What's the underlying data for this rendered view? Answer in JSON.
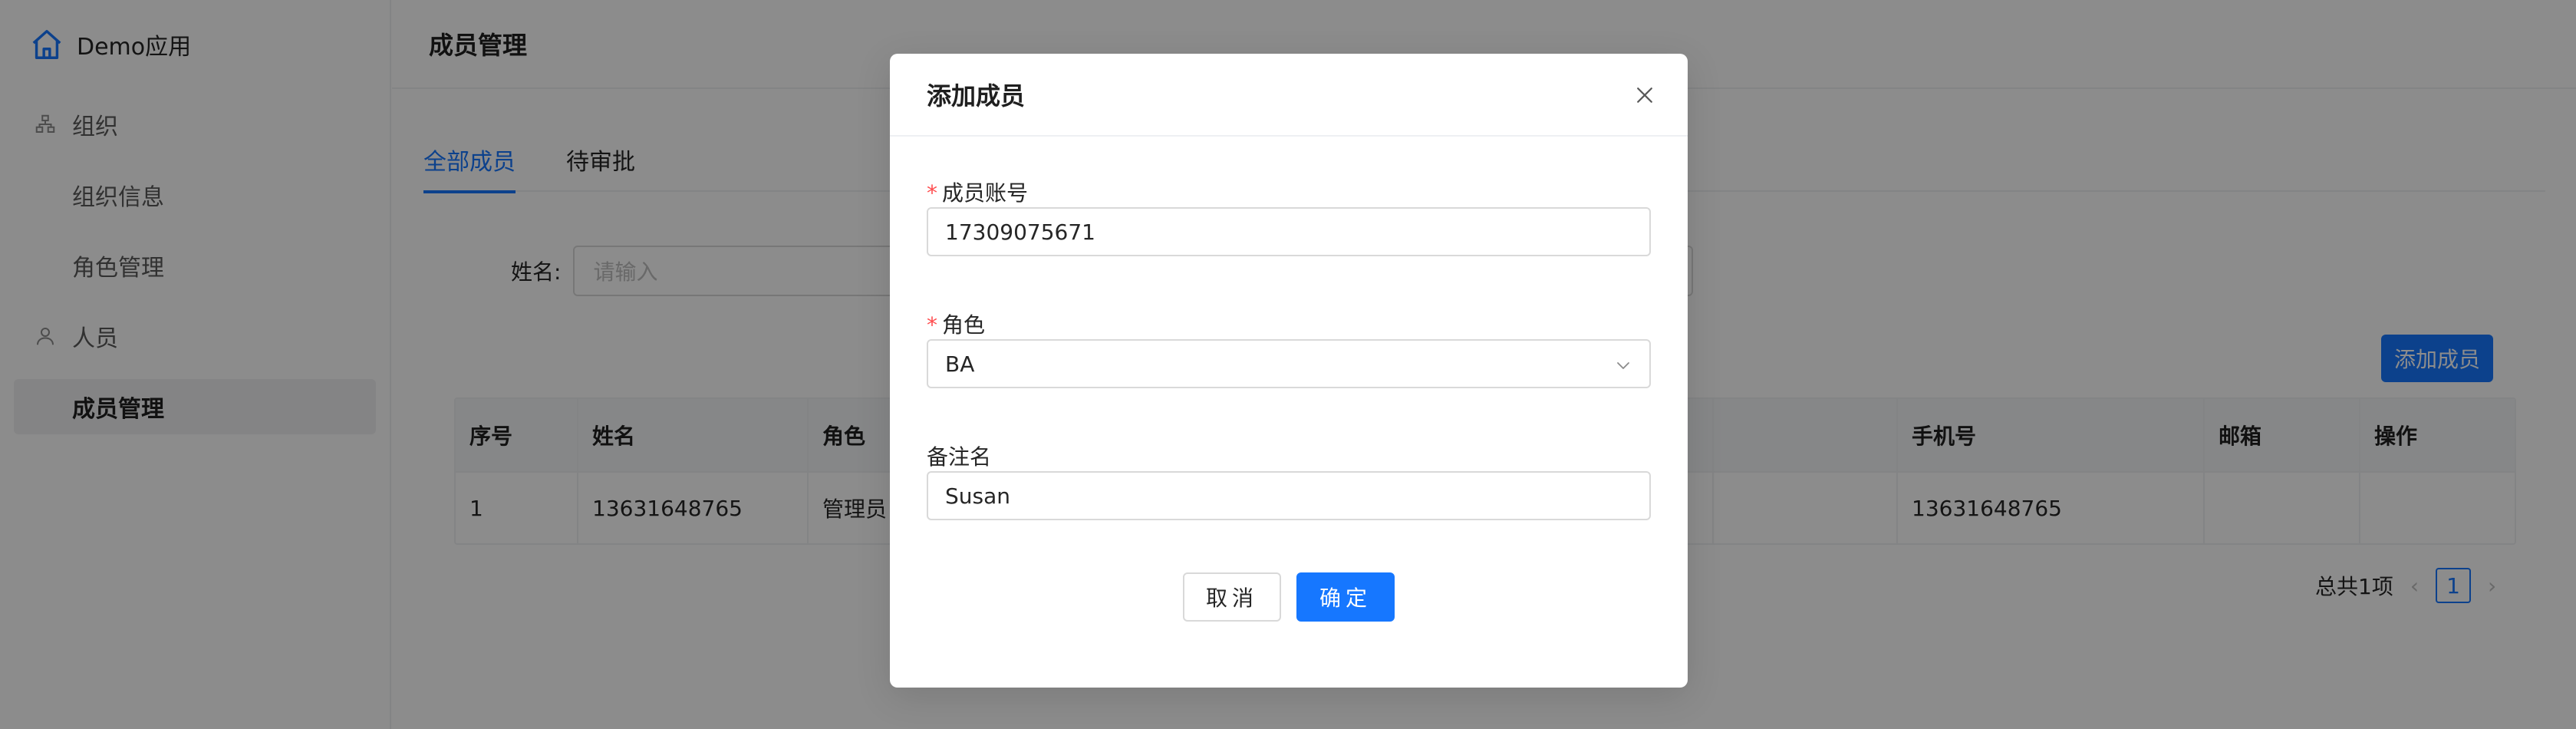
{
  "app": {
    "brand": "Demo应用",
    "page_title": "成员管理"
  },
  "sidebar": {
    "groups": [
      {
        "label": "组织",
        "icon": "org-icon",
        "items": [
          "组织信息",
          "角色管理"
        ]
      },
      {
        "label": "人员",
        "icon": "user-icon",
        "items": [
          "成员管理"
        ]
      }
    ],
    "active_item": "成员管理"
  },
  "tabs": [
    {
      "label": "全部成员",
      "active": true
    },
    {
      "label": "待审批",
      "active": false
    }
  ],
  "filter": {
    "name_label": "姓名:",
    "name_placeholder": "请输入"
  },
  "toolbar": {
    "add_member_label": "添加成员"
  },
  "table": {
    "columns": [
      "序号",
      "姓名",
      "角色",
      "",
      "手机号",
      "邮箱",
      "操作"
    ],
    "rows": [
      {
        "index": "1",
        "name": "13631648765",
        "role": "管理员",
        "phone": "13631648765",
        "email": "",
        "actions": ""
      }
    ]
  },
  "pagination": {
    "total_text": "总共1项",
    "current_page": "1"
  },
  "modal": {
    "title": "添加成员",
    "fields": {
      "account": {
        "label": "成员账号",
        "required": true,
        "value": "17309075671"
      },
      "role": {
        "label": "角色",
        "required": true,
        "value": "BA"
      },
      "remark": {
        "label": "备注名",
        "required": false,
        "value": "Susan"
      }
    },
    "cancel_label": "取消",
    "ok_label": "确定"
  },
  "colors": {
    "primary": "#1677ff",
    "required": "#ff4d4f",
    "mask": "rgba(0,0,0,0.45)"
  }
}
